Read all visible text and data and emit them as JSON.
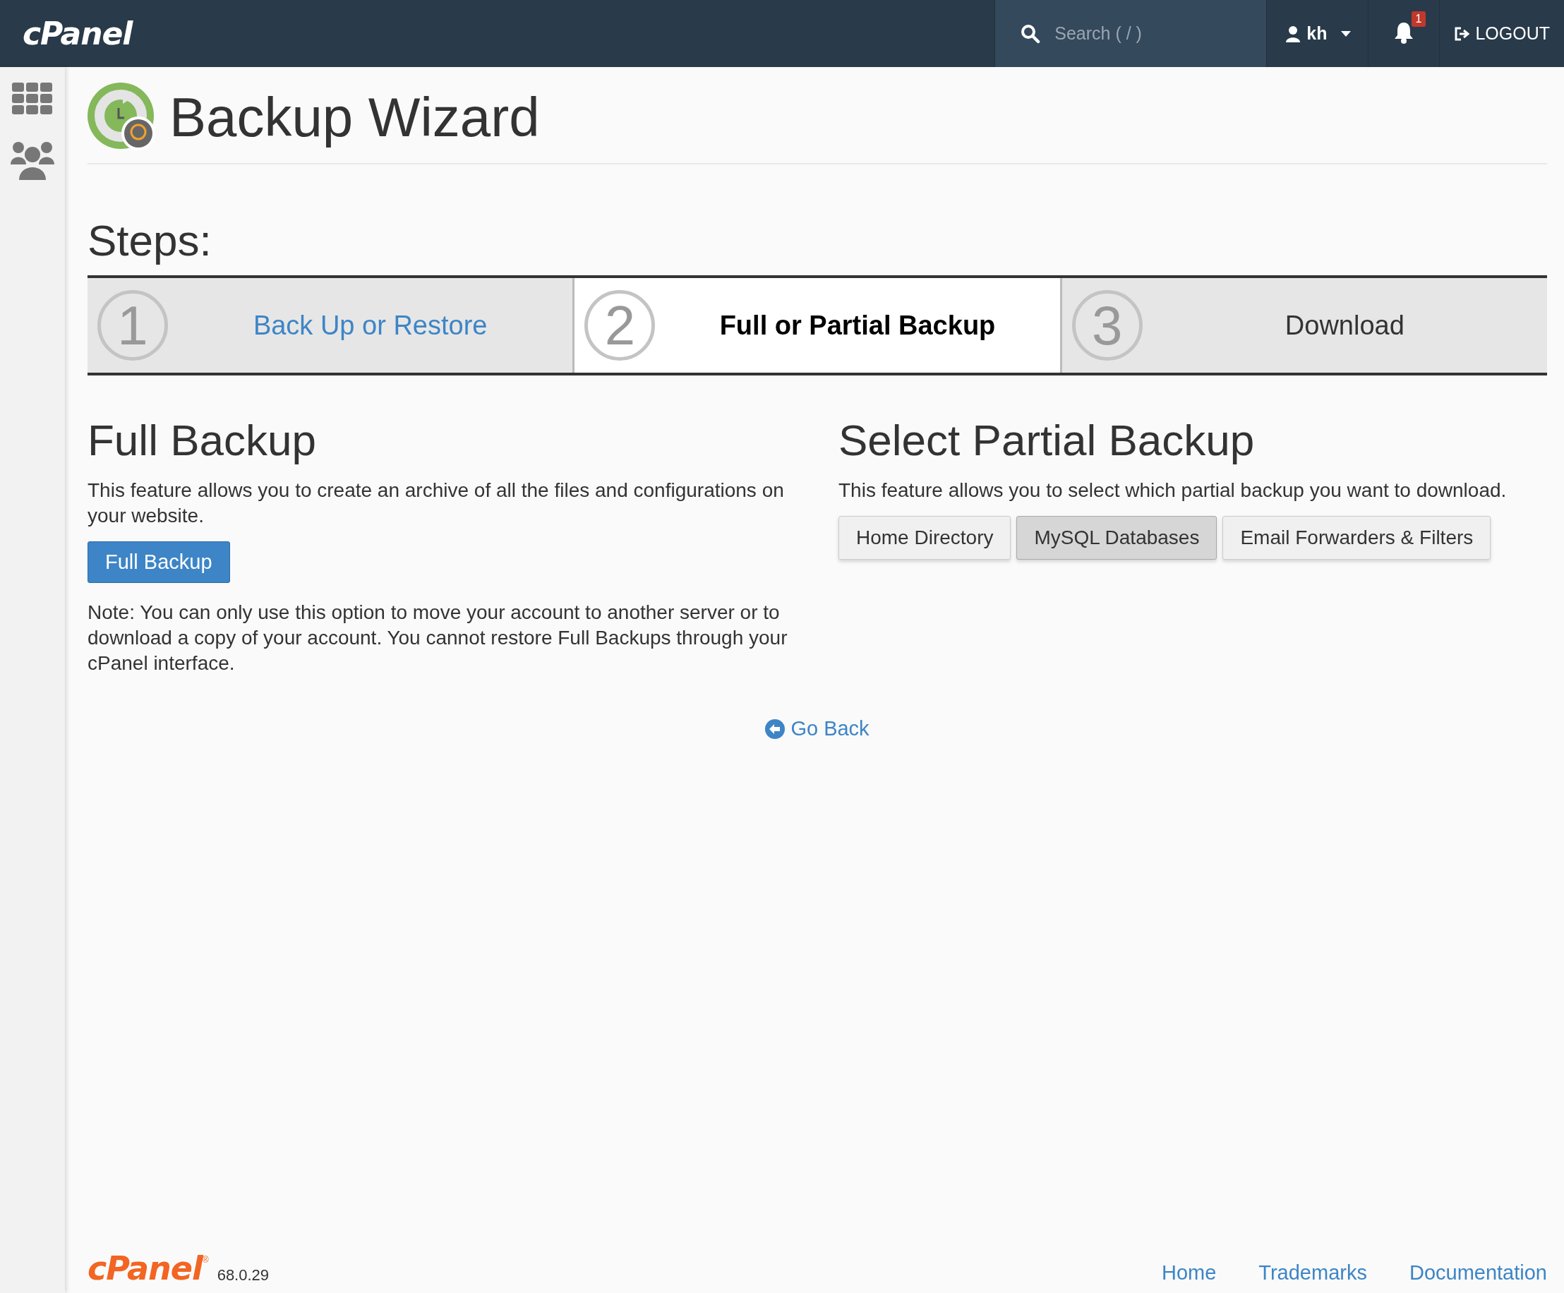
{
  "topbar": {
    "logo": "cPanel",
    "search": {
      "placeholder": "Search ( / )"
    },
    "user": "kh",
    "notifications": "1",
    "logout": "LOGOUT"
  },
  "page": {
    "title": "Backup Wizard"
  },
  "steps": {
    "heading": "Steps:",
    "items": [
      {
        "number": "1",
        "label": "Back Up or Restore",
        "completed": true,
        "selected": false
      },
      {
        "number": "2",
        "label": "Full or Partial Backup",
        "completed": false,
        "selected": true
      },
      {
        "number": "3",
        "label": "Download",
        "completed": false,
        "selected": false
      }
    ]
  },
  "full_backup": {
    "heading": "Full Backup",
    "description": "This feature allows you to create an archive of all the files and configurations on your website.",
    "button": "Full Backup",
    "note": "Note: You can only use this option to move your account to another server or to download a copy of your account. You cannot restore Full Backups through your cPanel interface."
  },
  "partial_backup": {
    "heading": "Select Partial Backup",
    "description": "This feature allows you to select which partial backup you want to download.",
    "buttons": [
      {
        "label": "Home Directory",
        "selected": false
      },
      {
        "label": "MySQL Databases",
        "selected": true
      },
      {
        "label": "Email Forwarders & Filters",
        "selected": false
      }
    ]
  },
  "go_back": "Go Back",
  "footer": {
    "logo": "cPanel",
    "registered": "®",
    "version": "68.0.29",
    "links": [
      "Home",
      "Trademarks",
      "Documentation"
    ]
  }
}
